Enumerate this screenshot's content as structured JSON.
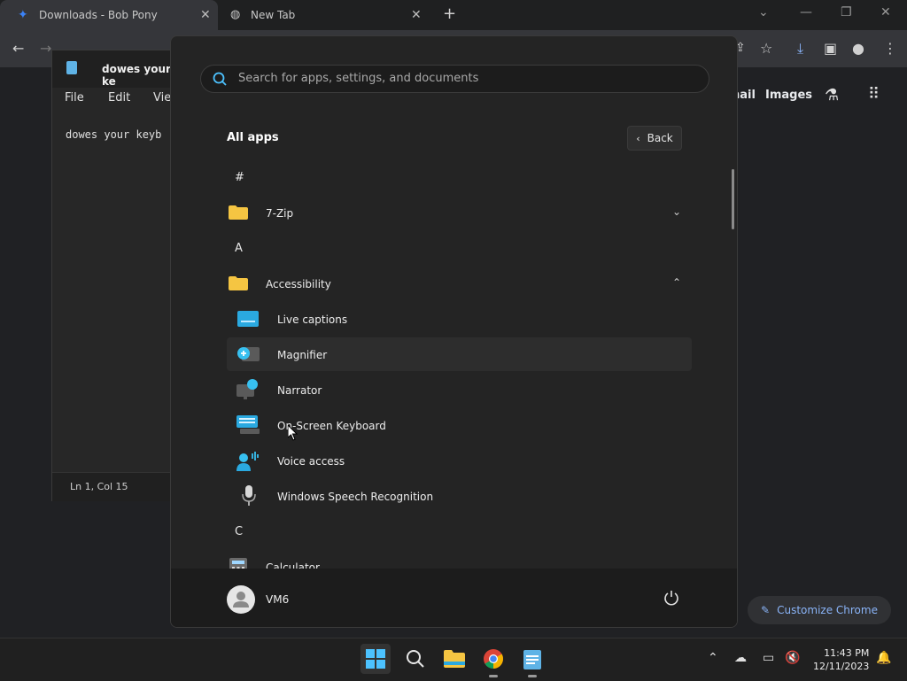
{
  "chrome": {
    "tabs": [
      {
        "title": "Downloads - Bob Pony"
      },
      {
        "title": "New Tab"
      }
    ],
    "google_nav": {
      "mail": "nail",
      "images": "Images"
    },
    "customize_label": "Customize Chrome"
  },
  "notepad": {
    "title": "dowes your ke",
    "menu": [
      "File",
      "Edit",
      "Vie"
    ],
    "text": "dowes your keyb",
    "status": "Ln 1, Col 15"
  },
  "start_menu": {
    "search_placeholder": "Search for apps, settings, and documents",
    "heading": "All apps",
    "back_label": "Back",
    "sections": [
      {
        "letter": "#"
      },
      {
        "letter": "A"
      },
      {
        "letter": "C"
      }
    ],
    "items": [
      {
        "label": "7-Zip",
        "kind": "folder",
        "expanded": false
      },
      {
        "label": "Accessibility",
        "kind": "folder",
        "expanded": true
      },
      {
        "label": "Live captions",
        "icon": "live-captions-icon"
      },
      {
        "label": "Magnifier",
        "icon": "magnifier-icon"
      },
      {
        "label": "Narrator",
        "icon": "narrator-icon"
      },
      {
        "label": "On-Screen Keyboard",
        "icon": "keyboard-icon"
      },
      {
        "label": "Voice access",
        "icon": "voice-access-icon"
      },
      {
        "label": "Windows Speech Recognition",
        "icon": "microphone-icon"
      },
      {
        "label": "Calculator",
        "icon": "calculator-icon"
      }
    ],
    "user": "VM6"
  },
  "taskbar": {
    "time": "11:43 PM",
    "date": "12/11/2023"
  },
  "colors": {
    "accent": "#4cc2ff",
    "folder": "#f5c542",
    "link": "#8ab4f8"
  }
}
